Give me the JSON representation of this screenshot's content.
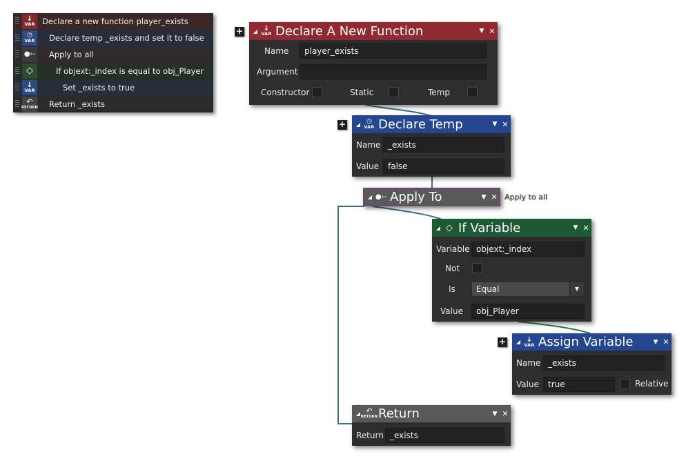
{
  "code_list": [
    {
      "icon": "var-icon",
      "text": "Declare a new function player_exists",
      "indent": 0
    },
    {
      "icon": "temp-var-icon",
      "text": "Declare temp _exists and set it to false",
      "indent": 1
    },
    {
      "icon": "apply-to-icon",
      "text": "Apply to all",
      "indent": 1
    },
    {
      "icon": "if-variable-icon",
      "text": "If objext:_index is equal to obj_Player",
      "indent": 2
    },
    {
      "icon": "var-icon",
      "text": "Set _exists to true",
      "indent": 3
    },
    {
      "icon": "return-icon",
      "text": "Return _exists",
      "indent": 1
    }
  ],
  "icon_text": {
    "var": "VAR",
    "ret": "RETURN"
  },
  "declare_function": {
    "title": "Declare A New Function",
    "name_label": "Name",
    "name_value": "player_exists",
    "argument_label": "Argument",
    "argument_value": "",
    "constructor_label": "Constructor",
    "static_label": "Static",
    "temp_label": "Temp"
  },
  "declare_temp": {
    "title": "Declare Temp",
    "name_label": "Name",
    "name_value": "_exists",
    "value_label": "Value",
    "value_value": "false"
  },
  "apply_to": {
    "title": "Apply To",
    "side_label": "Apply to all"
  },
  "if_variable": {
    "title": "If Variable",
    "variable_label": "Variable",
    "variable_value": "objext:_index",
    "not_label": "Not",
    "is_label": "Is",
    "is_value": "Equal",
    "value_label": "Value",
    "value_value": "obj_Player"
  },
  "assign_variable": {
    "title": "Assign Variable",
    "name_label": "Name",
    "name_value": "_exists",
    "value_label": "Value",
    "value_value": "true",
    "relative_label": "Relative"
  },
  "return_block": {
    "title": "Return",
    "return_label": "Return",
    "return_value": "_exists"
  },
  "colors": {
    "function_red": "#8e2a30",
    "variable_blue": "#23468e",
    "apply_grey": "#595959",
    "condition_green": "#1d5a34",
    "wire": "#3f6e80"
  }
}
